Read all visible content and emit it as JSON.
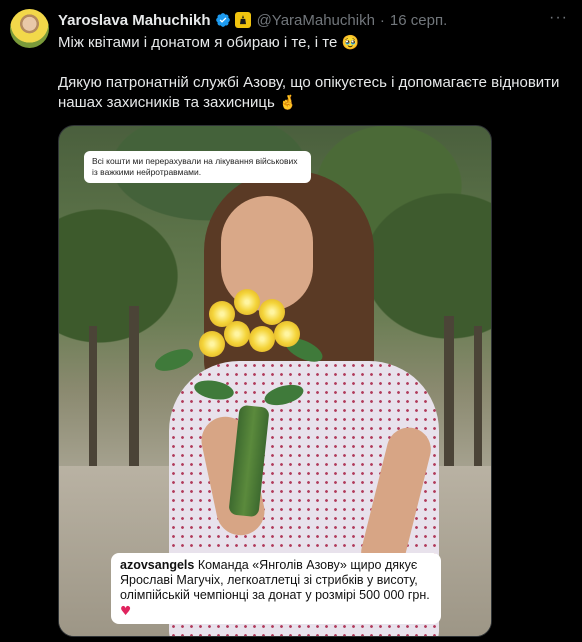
{
  "tweet": {
    "author_name": "Yaroslava Mahuchikh",
    "handle": "@YaraMahuchikh",
    "separator": "·",
    "date": "16 серп.",
    "more_label": "···",
    "line1": "Між квітами і донатом я обираю і те, і те",
    "line1_emoji": "🥹",
    "line2": "Дякую патронатній службі Азову, що опікуєтесь і допомагаєте відновити нашах захисників та захисниць",
    "line2_emoji": "🤞"
  },
  "media": {
    "top_caption": "Всі кошти ми перерахували на лікування військових із важкими нейротравмами.",
    "bottom_caption_user": "azovsangels",
    "bottom_caption_text": "Команда «Янголів Азову» щиро дякує Ярославі Магучіх, легкоатлетці зі стрибків у висоту, олімпійській чемпіонці за донат у розмірі 500 000 грн.",
    "bottom_caption_emoji": "♥"
  },
  "colors": {
    "background": "#000000",
    "text": "#e7e9ea",
    "muted": "#71767b",
    "verified": "#1d9bf0",
    "affiliate": "#f1c40f"
  }
}
